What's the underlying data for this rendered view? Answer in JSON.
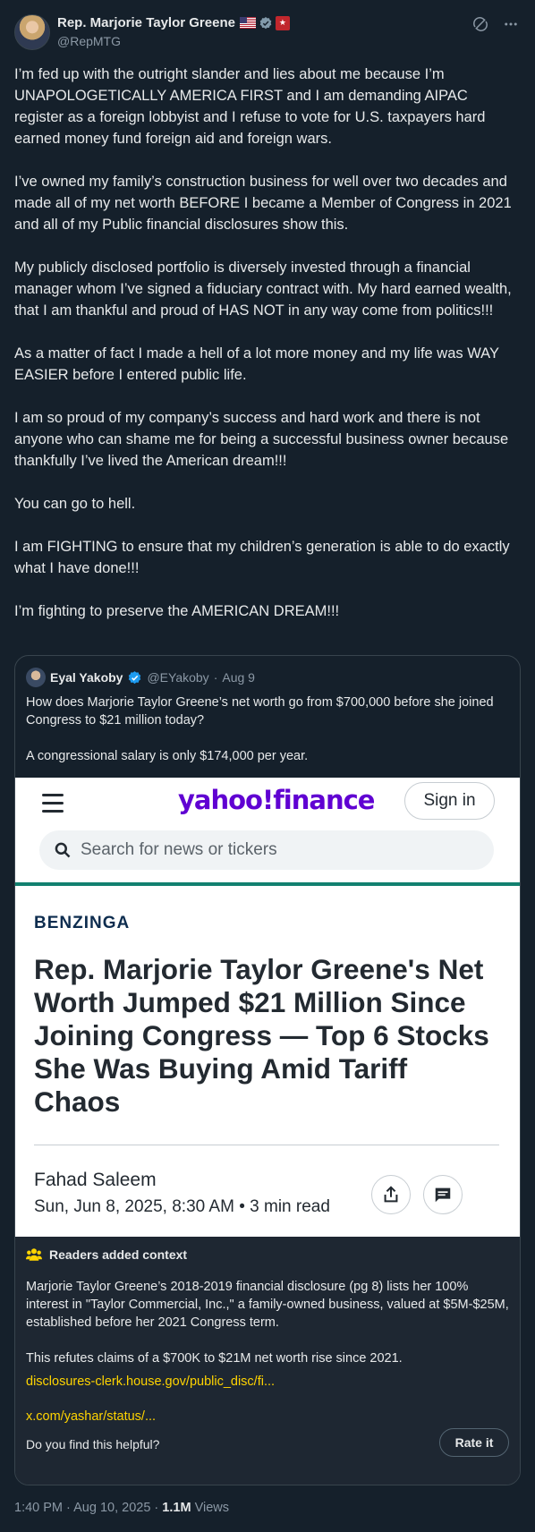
{
  "author": {
    "name": "Rep. Marjorie Taylor Greene",
    "handle": "@RepMTG",
    "icons": [
      "us-flag-icon",
      "verified-gray-badge-icon",
      "congress-label-icon"
    ]
  },
  "header_actions": [
    "grok-icon",
    "more-icon"
  ],
  "tweet": {
    "paragraphs": [
      "I’m fed up with the outright slander and lies about me because I’m UNAPOLOGETICALLY AMERICA FIRST and I am demanding AIPAC register as a foreign lobbyist and I refuse to vote for U.S. taxpayers hard earned money fund foreign aid and foreign wars.",
      "I’ve owned my family’s construction business for well over two decades and made all of my net worth BEFORE I became a Member of Congress in 2021 and all of my Public financial disclosures show this.",
      "My publicly disclosed portfolio is diversely invested through a financial manager whom I’ve signed a fiduciary contract with. My hard earned wealth, that I am thankful and proud of HAS NOT in any way come from politics!!!",
      "As a matter of fact I made a hell of a lot more money and my life was WAY EASIER before I entered public life.",
      "I am so proud of my company’s success and hard work and there is not anyone who can shame me for being a successful business owner because thankfully I’ve lived the American dream!!!",
      "You can go to hell.",
      "I am FIGHTING to ensure that my children’s generation is able to do exactly what I have done!!!",
      "I’m fighting to preserve the AMERICAN DREAM!!!"
    ]
  },
  "quote": {
    "name": "Eyal Yakoby",
    "handle": "@EYakoby",
    "date": "Aug 9",
    "separator": "·",
    "paragraphs": [
      "How does Marjorie Taylor Greene’s net worth go from $700,000 before she joined Congress to $21 million today?",
      "A congressional salary is only $174,000 per year."
    ]
  },
  "screenshot": {
    "logo": "yahoo!finance",
    "sign_in": "Sign in",
    "search_placeholder": "Search for news or tickers",
    "source": "BENZINGA",
    "headline": "Rep. Marjorie Taylor Greene's Net Worth Jumped $21 Million Since Joining Congress — Top 6 Stocks She Was Buying Amid Tariff Chaos",
    "byline": "Fahad Saleem",
    "date_line": "Sun, Jun 8, 2025, 8:30 AM • 3 min read",
    "colors": {
      "yahoo_purple": "#6001d2",
      "accent_teal": "#12806f",
      "benzinga_navy": "#0e2d4f"
    }
  },
  "context": {
    "title": "Readers added context",
    "paragraphs": [
      "Marjorie Taylor Greene’s 2018-2019 financial disclosure (pg 8) lists her 100% interest in \"Taylor Commercial, Inc.,\" a family-owned business, valued at $5M-$25M, established before her 2021 Congress term.",
      "This refutes claims of a $700K to $21M net worth rise since 2021."
    ],
    "links": [
      "disclosures-clerk.house.gov/public_disc/fi...",
      "x.com/yashar/status/..."
    ],
    "question": "Do you find this helpful?",
    "rate_button": "Rate it",
    "link_color": "#ffd400"
  },
  "footer": {
    "time": "1:40 PM",
    "date": "Aug 10, 2025",
    "separator": "·",
    "views_count": "1.1M",
    "views_label": "Views"
  },
  "theme": {
    "background": "#15202b",
    "text": "#e7e9ea",
    "muted": "#8b98a5",
    "border": "#38444d",
    "verified_blue": "#1d9bf0"
  }
}
